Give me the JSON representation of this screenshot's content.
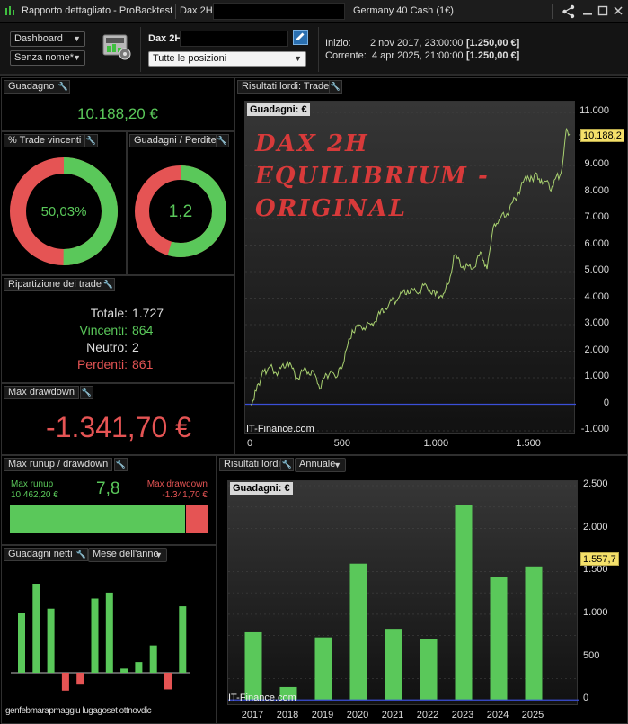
{
  "titlebar": {
    "app_title": "Rapporto dettagliato - ProBacktest",
    "system_name": "Dax 2H",
    "instrument": "Germany 40 Cash (1€)"
  },
  "toolbar": {
    "view_select": "Dashboard",
    "name_select": "Senza nome*",
    "system_label": "Dax 2H",
    "positions_select": "Tutte le posizioni",
    "start_label": "Inizio:",
    "start_date": "2 nov 2017, 23:00:00",
    "start_amount": "[1.250,00 €]",
    "current_label": "Corrente:",
    "current_date": "4 apr 2025, 21:00:00",
    "current_amount": "[1.250,00 €]"
  },
  "gain_panel": {
    "title": "Guadagno",
    "value": "10.188,20 €"
  },
  "winrate_panel": {
    "title": "% Trade vincenti",
    "value": "50,03%",
    "win_fraction": 0.5003
  },
  "ratio_panel": {
    "title": "Guadagni / Perdite",
    "value": "1,2",
    "gain_fraction": 0.545
  },
  "breakdown_panel": {
    "title": "Ripartizione dei trade",
    "total_label": "Totale:",
    "total_value": "1.727",
    "win_label": "Vincenti:",
    "win_value": "864",
    "neutral_label": "Neutro:",
    "neutral_value": "2",
    "loss_label": "Perdenti:",
    "loss_value": "861"
  },
  "drawdown_panel": {
    "title": "Max drawdown",
    "value": "-1.341,70 €"
  },
  "runup_panel": {
    "title": "Max runup / drawdown",
    "runup_label": "Max runup",
    "runup_value": "10.462,20 €",
    "ratio": "7,8",
    "dd_label": "Max drawdown",
    "dd_value": "-1.341,70 €",
    "runup_fraction": 0.886
  },
  "monthly_panel": {
    "title": "Guadagni netti",
    "mode_select": "Mese dell'anno",
    "months_label": "genfebmarapmaggiu lugagoset ottnovdic"
  },
  "equity_panel": {
    "title": "Risultati lordi: Trade",
    "chart_tag": "Guadagni: €",
    "overlay_line1": "DAX 2H",
    "overlay_line2": "EQUILIBRIUM -",
    "overlay_line3": "ORIGINAL",
    "last_value_label": "10.188,2",
    "watermark": "IT-Finance.com"
  },
  "annual_panel": {
    "title": "Risultati lordi",
    "mode_select": "Annuale",
    "chart_tag": "Guadagni: €",
    "last_value_label": "1.557,7",
    "watermark": "IT-Finance.com"
  },
  "colors": {
    "green": "#5ac85a",
    "red": "#e55454",
    "overlay": "#d83a3a"
  },
  "chart_data": [
    {
      "type": "line",
      "title": "Risultati lordi: Trade",
      "ylabel": "Guadagni: €",
      "x_ticks": [
        "0",
        "500",
        "1.000",
        "1.500"
      ],
      "y_ticks": [
        "11.000",
        "10.000",
        "9.000",
        "8.000",
        "7.000",
        "6.000",
        "5.000",
        "4.000",
        "3.000",
        "2.000",
        "1.000",
        "0",
        "-1.000"
      ],
      "xlim": [
        0,
        1727
      ],
      "ylim": [
        -1000,
        11000
      ],
      "x": [
        0,
        30,
        60,
        100,
        150,
        200,
        250,
        300,
        350,
        380,
        400,
        430,
        460,
        500,
        550,
        600,
        650,
        700,
        750,
        800,
        850,
        900,
        950,
        1000,
        1050,
        1080,
        1100,
        1150,
        1200,
        1250,
        1280,
        1300,
        1320,
        1350,
        1400,
        1450,
        1500,
        1530,
        1550,
        1580,
        1600,
        1620,
        1650,
        1680,
        1700,
        1710,
        1727
      ],
      "y": [
        0,
        500,
        1100,
        1400,
        1200,
        1600,
        1000,
        1300,
        1100,
        600,
        1000,
        1200,
        1000,
        1500,
        2800,
        2900,
        3000,
        3400,
        3800,
        4000,
        4300,
        4200,
        4500,
        4100,
        4200,
        4800,
        5600,
        5200,
        5100,
        5700,
        5100,
        6000,
        6800,
        7000,
        7300,
        8000,
        8600,
        8400,
        8700,
        8300,
        8400,
        8100,
        8500,
        8700,
        9800,
        10400,
        10188
      ]
    },
    {
      "type": "bar",
      "title": "Risultati lordi",
      "ylabel": "Guadagni: €",
      "categories": [
        "2017",
        "2018",
        "2019",
        "2020",
        "2021",
        "2022",
        "2023",
        "2024",
        "2025"
      ],
      "values": [
        790,
        150,
        730,
        1590,
        830,
        710,
        2270,
        1440,
        1557.7
      ],
      "y_ticks": [
        "2.500",
        "2.000",
        "1.500",
        "1.000",
        "500",
        "0"
      ],
      "ylim": [
        -50,
        2500
      ]
    },
    {
      "type": "bar",
      "title": "Guadagni netti",
      "categories": [
        "gen",
        "feb",
        "mar",
        "apr",
        "mag",
        "giu",
        "lug",
        "ago",
        "set",
        "ott",
        "nov",
        "dic"
      ],
      "values": [
        1000,
        1500,
        1080,
        -300,
        -200,
        1250,
        1350,
        70,
        180,
        460,
        -280,
        1120
      ]
    }
  ]
}
